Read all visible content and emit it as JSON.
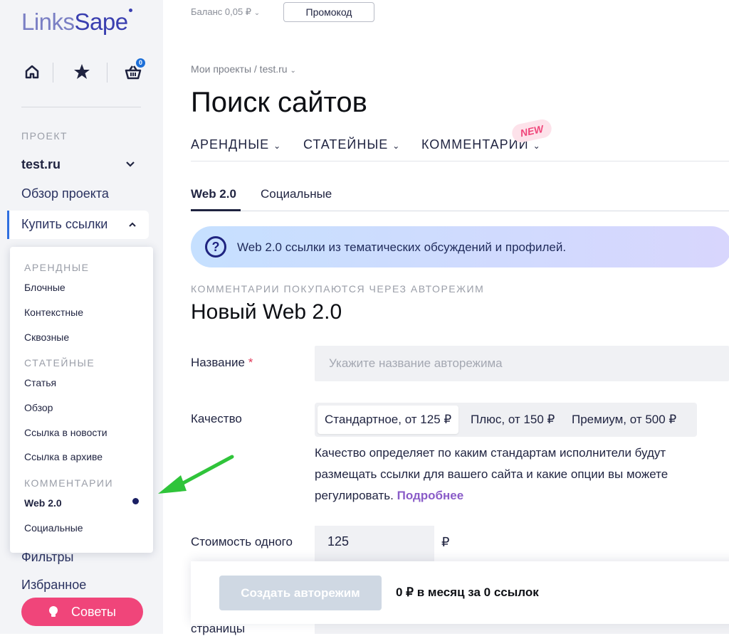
{
  "app": {
    "logo_links": "Links",
    "logo_sape": "Sape"
  },
  "sidebar": {
    "cart_count": "0",
    "section_label": "ПРОЕКТ",
    "project_name": "test.ru",
    "nav": {
      "overview": "Обзор проекта",
      "buy": "Купить ссылки",
      "filters": "Фильтры",
      "favorites": "Избранное"
    },
    "tips_label": "Советы",
    "dropdown": {
      "rent_head": "АРЕНДНЫЕ",
      "rent_items": [
        "Блочные",
        "Контекстные",
        "Сквозные"
      ],
      "article_head": "СТАТЕЙНЫЕ",
      "article_items": [
        "Статья",
        "Обзор",
        "Ссылка в новости",
        "Ссылка в архиве"
      ],
      "comments_head": "КОММЕНТАРИИ",
      "comments_items": [
        "Web 2.0",
        "Социальные"
      ]
    }
  },
  "header": {
    "balance": "Баланс 0,05 ₽",
    "promo_button": "Промокод"
  },
  "breadcrumb": "Мои проекты / test.ru",
  "page_title": "Поиск сайтов",
  "top_tabs": [
    "АРЕНДНЫЕ",
    "СТАТЕЙНЫЕ",
    "КОММЕНТАРИИ"
  ],
  "new_badge": "NEW",
  "sub_tabs": [
    "Web 2.0",
    "Социальные"
  ],
  "info_banner": "Web 2.0 ссылки из тематических обсуждений и профилей.",
  "form": {
    "overline": "КОММЕНТАРИИ ПОКУПАЮТСЯ ЧЕРЕЗ АВТОРЕЖИМ",
    "heading": "Новый Web 2.0",
    "name_label": "Название",
    "name_placeholder": "Укажите название авторежима",
    "required_mark": "*",
    "quality_label": "Качество",
    "quality_options": [
      "Стандартное, от 125 ₽",
      "Плюс, от 150 ₽",
      "Премиум, от 500 ₽"
    ],
    "quality_desc": "Качество определяет по каким стандартам исполнители будут размещать ссылки для вашего сайта и какие опции вы можете регулировать.",
    "quality_more": "Подробнее",
    "cost_label": "Стоимость одного",
    "cost_value": "125",
    "currency": "₽",
    "page_label": "страницы"
  },
  "footer": {
    "create_button": "Создать авторежим",
    "summary": "0 ₽ в месяц за 0 ссылок"
  },
  "colors": {
    "accent": "#2f6fe0",
    "tips": "#f0457a",
    "link": "#8a5cc8",
    "arrow": "#2fc43a"
  }
}
